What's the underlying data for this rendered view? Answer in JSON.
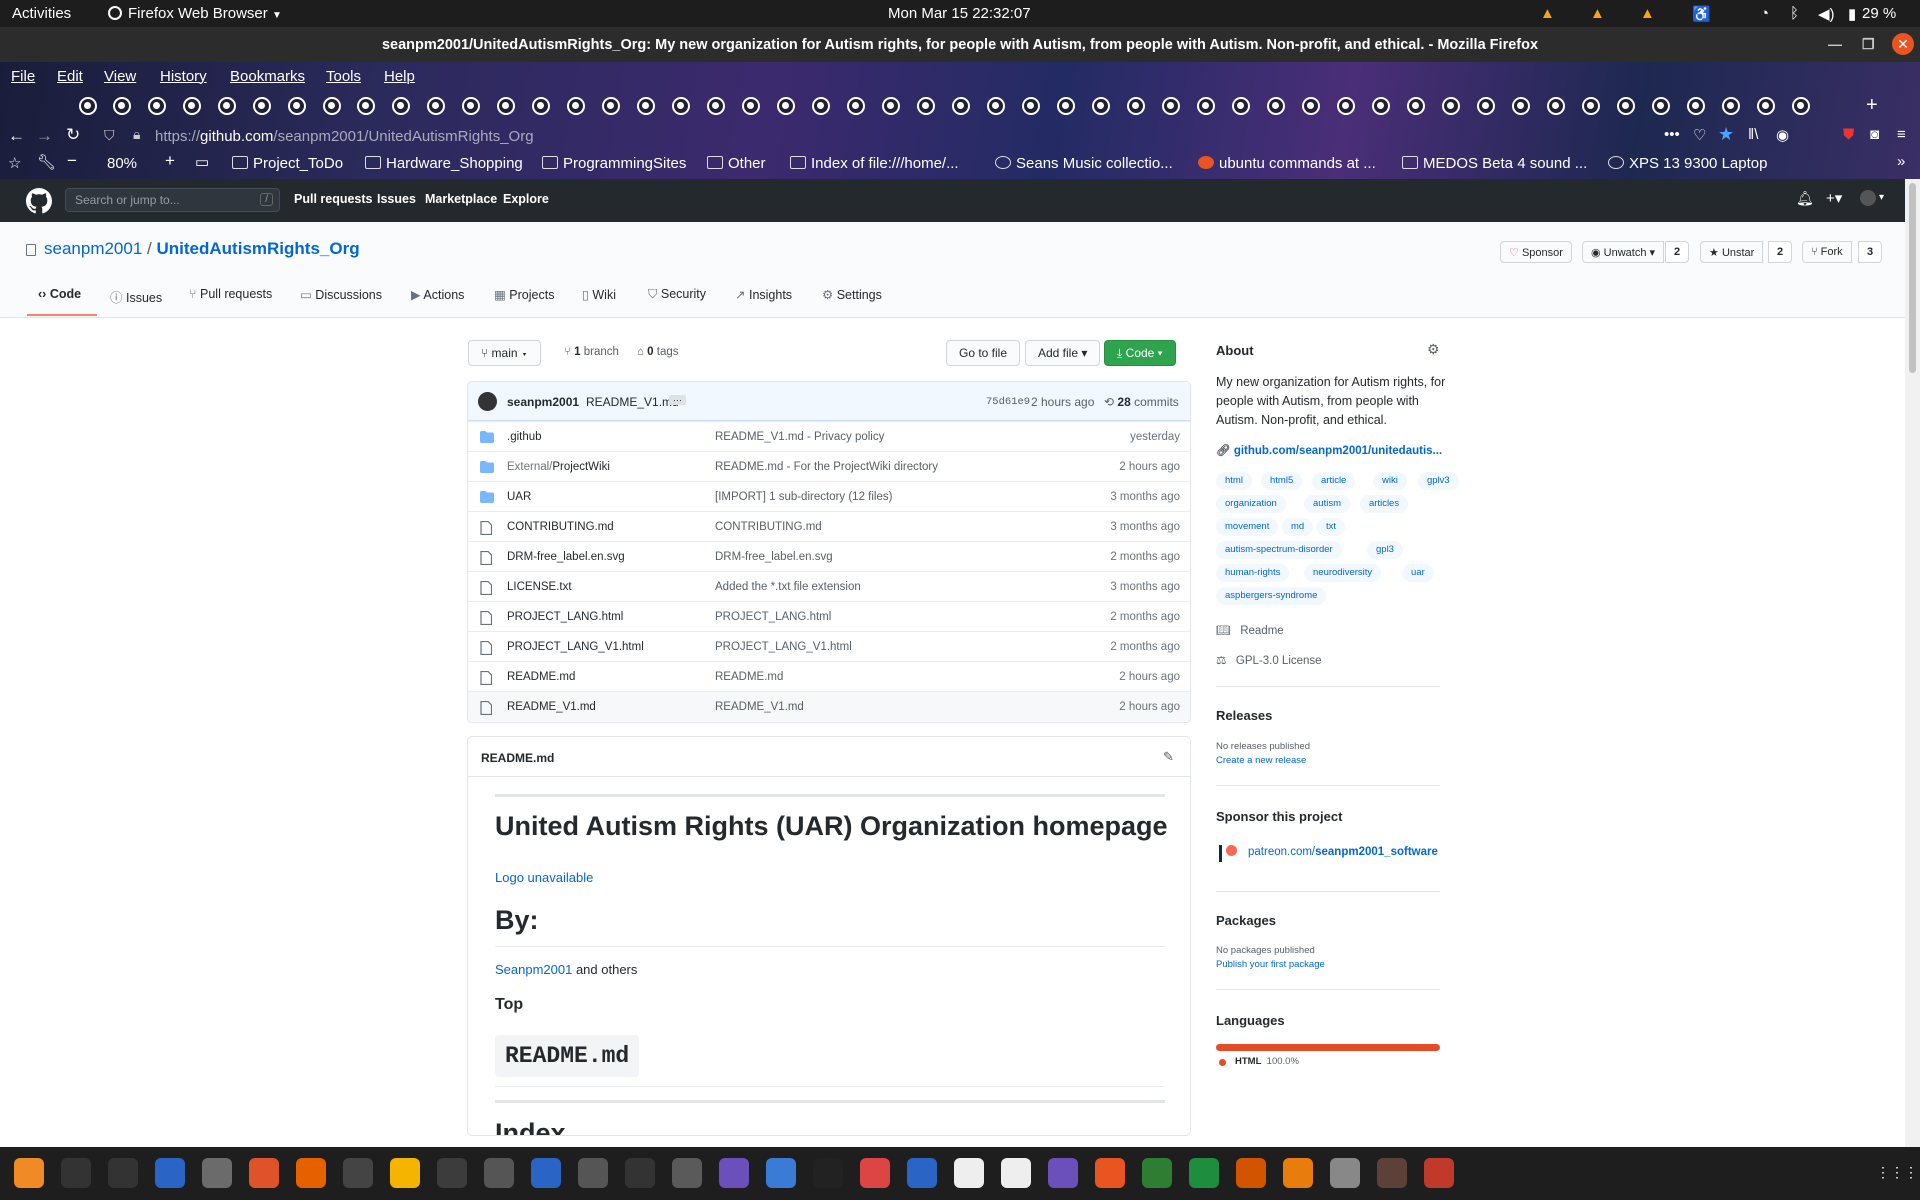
{
  "system": {
    "activities": "Activities",
    "app_menu": "Firefox Web Browser",
    "clock": "Mon Mar 15  22:32:07",
    "battery": "29 %"
  },
  "window": {
    "title": "seanpm2001/UnitedAutismRights_Org: My new organization for Autism rights, for people with Autism, from people with Autism. Non-profit, and ethical. - Mozilla Firefox"
  },
  "menubar": [
    "File",
    "Edit",
    "View",
    "History",
    "Bookmarks",
    "Tools",
    "Help"
  ],
  "navbar": {
    "url_prefix": "https://",
    "url_host": "github.com",
    "url_path": "/seanpm2001/UnitedAutismRights_Org",
    "zoom": "80%"
  },
  "bookmarks": [
    "Project_ToDo",
    "Hardware_Shopping",
    "ProgrammingSites",
    "Other",
    "Index of file:///home/...",
    "Seans Music collectio...",
    "ubuntu commands at ...",
    "MEDOS Beta 4 sound ...",
    "XPS 13 9300 Laptop"
  ],
  "github": {
    "search_placeholder": "Search or jump to...",
    "search_key": "/",
    "nav": [
      "Pull requests",
      "Issues",
      "Marketplace",
      "Explore"
    ]
  },
  "repo": {
    "owner": "seanpm2001",
    "separator": "/",
    "name": "UnitedAutismRights_Org",
    "sponsor": "Sponsor",
    "unwatch": "Unwatch",
    "unwatch_count": "2",
    "unstar": "Unstar",
    "star_count": "2",
    "fork": "Fork",
    "fork_count": "3",
    "tabs": [
      "Code",
      "Issues",
      "Pull requests",
      "Discussions",
      "Actions",
      "Projects",
      "Wiki",
      "Security",
      "Insights",
      "Settings"
    ]
  },
  "filebar": {
    "branch": "main",
    "branch_count": "1",
    "branch_label": "branch",
    "tag_count": "0",
    "tag_label": "tags",
    "go_to_file": "Go to file",
    "add_file": "Add file",
    "code": "Code"
  },
  "commit": {
    "author": "seanpm2001",
    "message": "README_V1.md",
    "hash": "75d61e9",
    "time": "2 hours ago",
    "count": "28",
    "count_label": "commits"
  },
  "files": [
    {
      "type": "dir",
      "name": ".github",
      "message": "README_V1.md - Privacy policy",
      "time": "yesterday"
    },
    {
      "type": "dir",
      "name": "External/ProjectWiki",
      "message": "README.md - For the ProjectWiki directory",
      "time": "2 hours ago"
    },
    {
      "type": "dir",
      "name": "UAR",
      "message": "[IMPORT] 1 sub-directory (12 files)",
      "time": "3 months ago"
    },
    {
      "type": "file",
      "name": "CONTRIBUTING.md",
      "message": "CONTRIBUTING.md",
      "time": "3 months ago"
    },
    {
      "type": "file",
      "name": "DRM-free_label.en.svg",
      "message": "DRM-free_label.en.svg",
      "time": "2 months ago"
    },
    {
      "type": "file",
      "name": "LICENSE.txt",
      "message": "Added the *.txt file extension",
      "time": "3 months ago"
    },
    {
      "type": "file",
      "name": "PROJECT_LANG.html",
      "message": "PROJECT_LANG.html",
      "time": "2 months ago"
    },
    {
      "type": "file",
      "name": "PROJECT_LANG_V1.html",
      "message": "PROJECT_LANG_V1.html",
      "time": "2 months ago"
    },
    {
      "type": "file",
      "name": "README.md",
      "message": "README.md",
      "time": "2 hours ago"
    },
    {
      "type": "file",
      "name": "README_V1.md",
      "message": "README_V1.md",
      "time": "2 hours ago"
    }
  ],
  "readme": {
    "filename": "README.md",
    "h1": "United Autism Rights (UAR) Organization homepage",
    "logo_link": "Logo unavailable",
    "h2_by": "By:",
    "author_link": "Seanpm2001",
    "author_rest": " and others",
    "h3_top": "Top",
    "code_title": "README.md",
    "h2_index": "Index"
  },
  "about": {
    "heading": "About",
    "description": "My new organization for Autism rights, for people with Autism, from people with Autism. Non-profit, and ethical.",
    "link": "github.com/seanpm2001/unitedautis...",
    "topics": [
      "html",
      "html5",
      "article",
      "wiki",
      "gplv3",
      "organization",
      "autism",
      "articles",
      "movement",
      "md",
      "txt",
      "autism-spectrum-disorder",
      "gpl3",
      "human-rights",
      "neurodiversity",
      "uar",
      "aspbergers-syndrome"
    ],
    "readme": "Readme",
    "license": "GPL-3.0 License"
  },
  "releases": {
    "heading": "Releases",
    "empty": "No releases published",
    "create": "Create a new release"
  },
  "sponsor_section": {
    "heading": "Sponsor this project",
    "link_prefix": "patreon.com/",
    "link_user": "seanpm2001_software"
  },
  "packages": {
    "heading": "Packages",
    "empty": "No packages published",
    "publish": "Publish your first package"
  },
  "languages": {
    "heading": "Languages",
    "name": "HTML",
    "percent": "100.0%",
    "fraction": 1.0,
    "color": "#e34c26"
  }
}
